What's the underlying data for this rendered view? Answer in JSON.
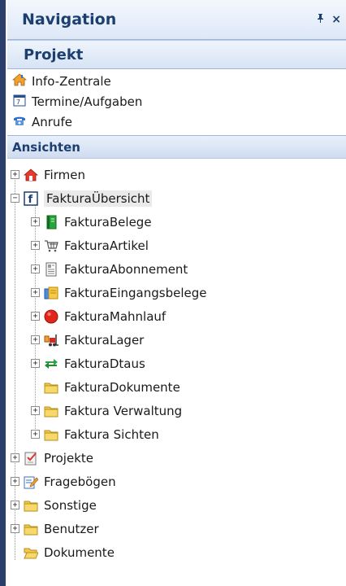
{
  "pane": {
    "title": "Navigation",
    "pin_glyph": "ᵖ",
    "close_glyph": "×"
  },
  "projekt": {
    "header": "Projekt",
    "items": [
      {
        "label": "Info-Zentrale",
        "icon": "home-icon"
      },
      {
        "label": "Termine/Aufgaben",
        "icon": "calendar-icon"
      },
      {
        "label": "Anrufe",
        "icon": "phone-icon"
      }
    ]
  },
  "ansichten": {
    "header": "Ansichten",
    "tree": [
      {
        "label": "Firmen",
        "icon": "house-icon",
        "toggle": "+"
      },
      {
        "label": "FakturaÜbersicht",
        "icon": "faktura-f-icon",
        "toggle": "−",
        "selected": true,
        "children": [
          {
            "label": "FakturaBelege",
            "icon": "green-book-icon",
            "toggle": "+"
          },
          {
            "label": "FakturaArtikel",
            "icon": "cart-icon",
            "toggle": "+"
          },
          {
            "label": "FakturaAbonnement",
            "icon": "document-icon",
            "toggle": "+"
          },
          {
            "label": "FakturaEingangsbelege",
            "icon": "incoming-docs-icon",
            "toggle": "+"
          },
          {
            "label": "FakturaMahnlauf",
            "icon": "red-circle-icon",
            "toggle": "+"
          },
          {
            "label": "FakturaLager",
            "icon": "forklift-icon",
            "toggle": "+"
          },
          {
            "label": "FakturaDtaus",
            "icon": "transfer-arrows-icon",
            "toggle": "+"
          },
          {
            "label": "FakturaDokumente",
            "icon": "folder-icon",
            "toggle": ""
          },
          {
            "label": "Faktura Verwaltung",
            "icon": "folder-icon",
            "toggle": "+"
          },
          {
            "label": "Faktura Sichten",
            "icon": "folder-icon",
            "toggle": "+"
          }
        ]
      },
      {
        "label": "Projekte",
        "icon": "checklist-icon",
        "toggle": "+"
      },
      {
        "label": "Fragebögen",
        "icon": "form-pencil-icon",
        "toggle": "+"
      },
      {
        "label": "Sonstige",
        "icon": "folder-icon",
        "toggle": "+"
      },
      {
        "label": "Benutzer",
        "icon": "folder-icon",
        "toggle": "+"
      },
      {
        "label": "Dokumente",
        "icon": "open-folder-icon",
        "toggle": ""
      }
    ]
  },
  "colors": {
    "header_text": "#1d3f70",
    "folder": "#f2c94c",
    "green": "#27a53a",
    "red": "#e0261b"
  }
}
